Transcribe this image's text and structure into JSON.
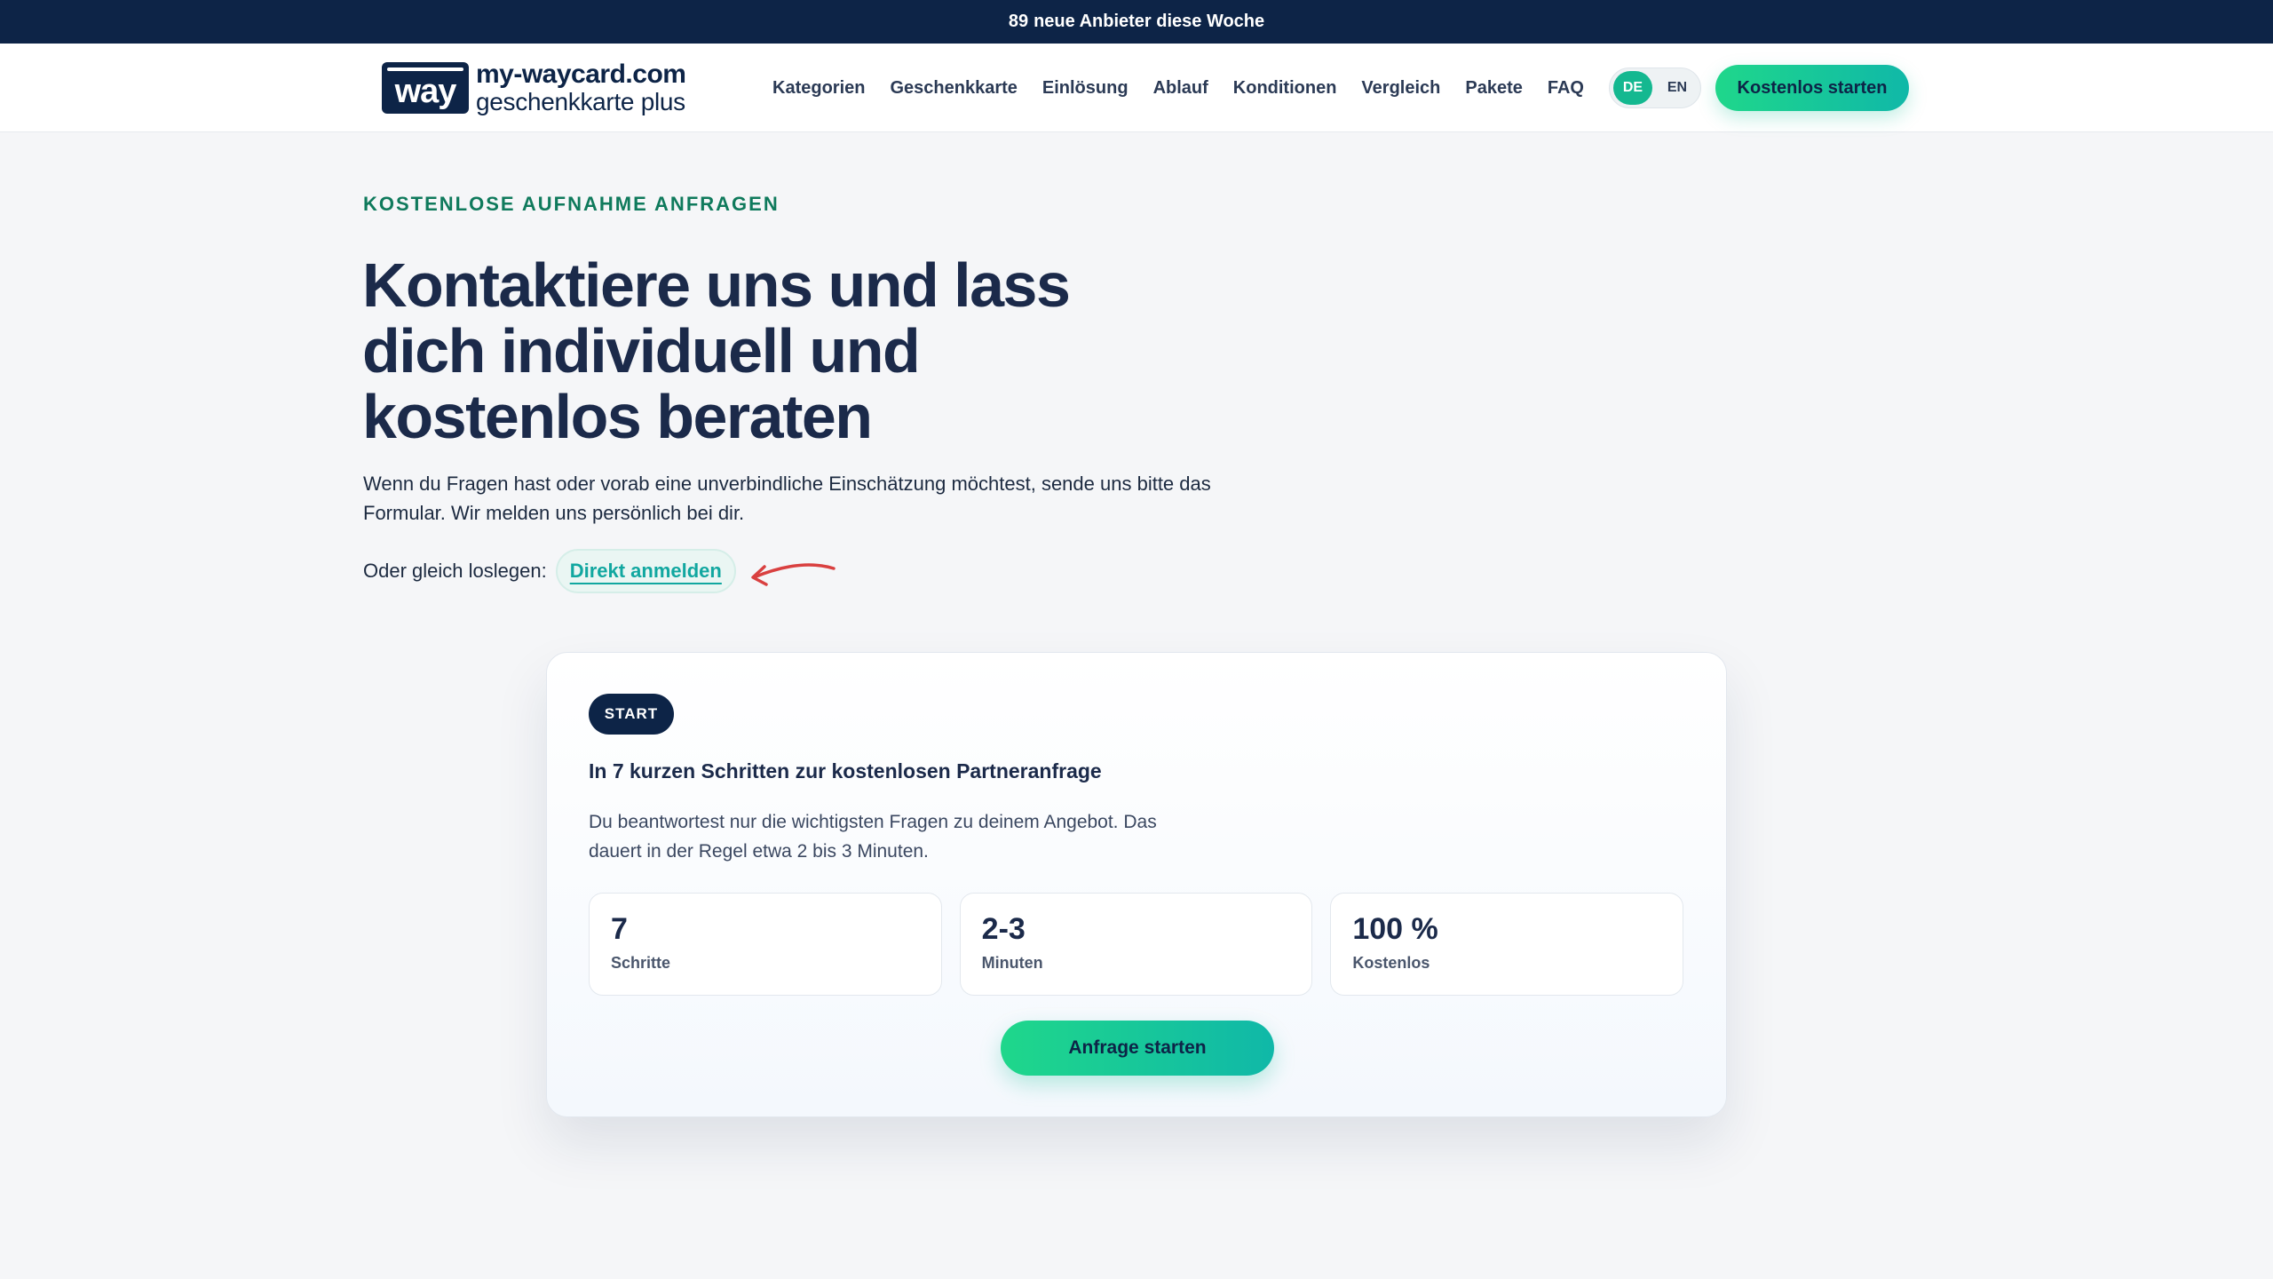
{
  "announcement": {
    "count": "89",
    "text": "neue Anbieter diese Woche"
  },
  "brand": {
    "badge": "way",
    "domain": "my-waycard.com",
    "tagline": "geschenkkarte plus"
  },
  "nav": {
    "items": [
      {
        "label": "Kategorien"
      },
      {
        "label": "Geschenkkarte"
      },
      {
        "label": "Einlösung"
      },
      {
        "label": "Ablauf"
      },
      {
        "label": "Konditionen"
      },
      {
        "label": "Vergleich"
      },
      {
        "label": "Pakete"
      },
      {
        "label": "FAQ"
      }
    ]
  },
  "language": {
    "options": [
      "DE",
      "EN"
    ],
    "selected": "DE"
  },
  "header_cta": "Kostenlos starten",
  "hero": {
    "eyebrow": "KOSTENLOSE AUFNAHME ANFRAGEN",
    "headline": "Kontaktiere uns und lass dich individuell und kostenlos beraten",
    "intro": "Wenn du Fragen hast oder vorab eine unverbindliche Einschätzung möchtest, sende uns bitte das Formular. Wir melden uns persönlich bei dir.",
    "direct_prefix": "Oder gleich loslegen:",
    "direct_link": "Direkt anmelden"
  },
  "card": {
    "pill": "START",
    "title": "In 7 kurzen Schritten zur kostenlosen Partneranfrage",
    "text": "Du beantwortest nur die wichtigsten Fragen zu deinem Angebot. Das dauert in der Regel etwa 2 bis 3 Minuten.",
    "stats": [
      {
        "value": "7",
        "label": "Schritte"
      },
      {
        "value": "2-3",
        "label": "Minuten"
      },
      {
        "value": "100 %",
        "label": "Kostenlos"
      }
    ],
    "cta": "Anfrage starten"
  },
  "colors": {
    "navy": "#0d2447",
    "accent_green": "#1fd78b",
    "accent_teal": "#10b8a8",
    "link": "#11a7a0",
    "arrow": "#d94040"
  }
}
